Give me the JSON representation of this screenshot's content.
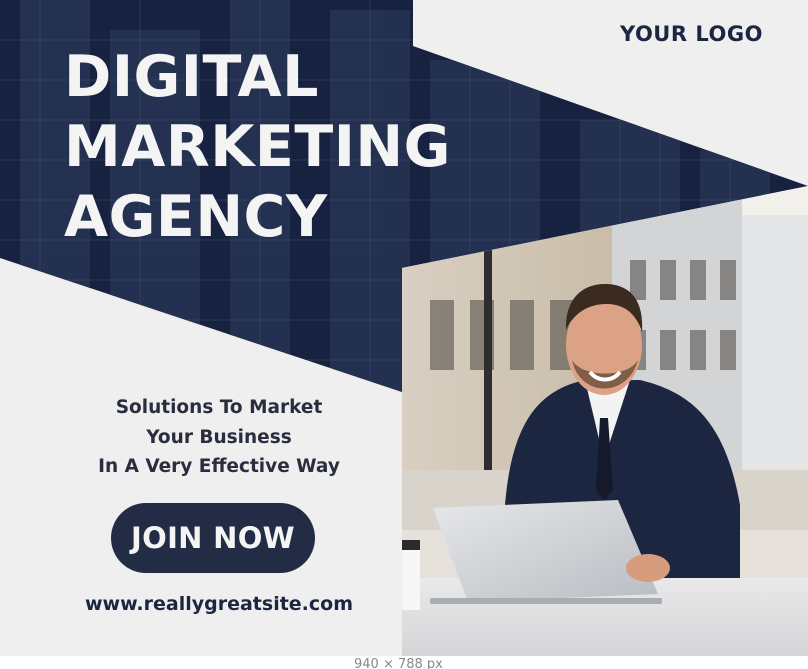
{
  "brand": {
    "logo_text": "YOUR LOGO"
  },
  "headline": {
    "line1": "DIGITAL",
    "line2": "MARKETING",
    "line3": "AGENCY"
  },
  "tagline": {
    "line1": "Solutions To Market",
    "line2": "Your Business",
    "line3": "In A Very Effective Way"
  },
  "cta": {
    "label": "JOIN NOW"
  },
  "website": "www.reallygreatsite.com",
  "canvas_dimensions": "940 × 788 px",
  "colors": {
    "navy": "#16223f",
    "button": "#232c45",
    "panel": "#efefef",
    "headline_text": "#f4f4f4"
  },
  "photo_description": "business man with laptop at outdoor table"
}
